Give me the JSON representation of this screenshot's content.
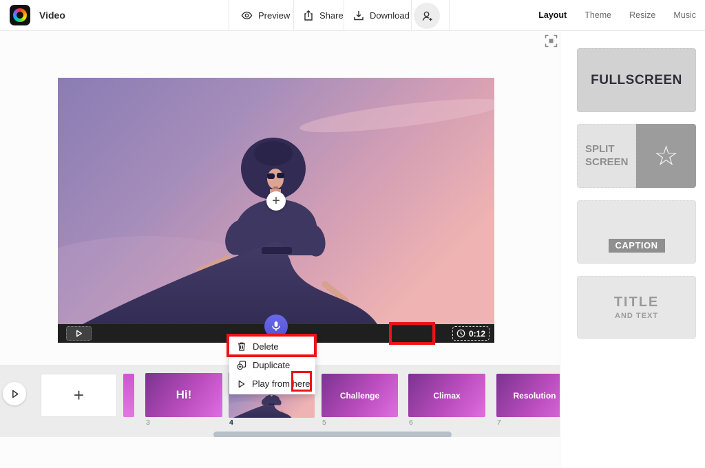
{
  "topbar": {
    "title": "Video",
    "preview_label": "Preview",
    "share_label": "Share",
    "download_label": "Download",
    "nav": {
      "layout": "Layout",
      "theme": "Theme",
      "resize": "Resize",
      "music": "Music"
    }
  },
  "canvas": {
    "add_label": "+",
    "timer": "0:12"
  },
  "menu": {
    "delete": "Delete",
    "duplicate": "Duplicate",
    "play_from_here": "Play from here"
  },
  "panel": {
    "fullscreen": "FULLSCREEN",
    "split_line1": "SPLIT",
    "split_line2": "SCREEN",
    "caption": "CAPTION",
    "title_big": "TITLE",
    "title_small": "AND TEXT"
  },
  "timeline": {
    "add_label": "+",
    "slides": [
      {
        "num": "3",
        "label": "Hi!"
      },
      {
        "num": "4",
        "label": ""
      },
      {
        "num": "5",
        "label": "Challenge"
      },
      {
        "num": "6",
        "label": "Climax"
      },
      {
        "num": "7",
        "label": "Resolution"
      }
    ]
  },
  "icons": {
    "star": "☆"
  },
  "colors": {
    "annotation_red": "#ec1218",
    "mic_blue": "#5b5be0",
    "slide_magenta_dark": "#7b3390",
    "slide_magenta_bright": "#e06ee0",
    "timeline_bg": "#ececec"
  }
}
